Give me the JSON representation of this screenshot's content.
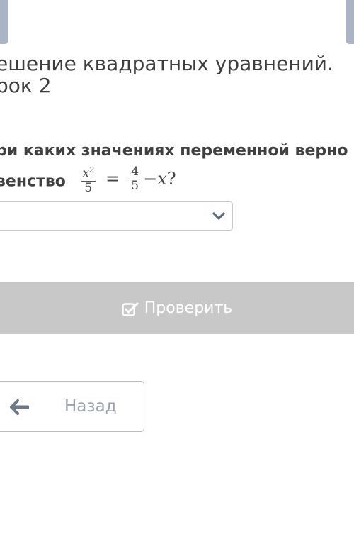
{
  "header": {
    "left_button_icon": "nav-button",
    "right_button_icon": "nav-button"
  },
  "lesson": {
    "title_line1": "ешение квадратных уравнений.",
    "title_line2": "рок 2"
  },
  "question": {
    "line1": "ри каких значениях переменной верно",
    "line2_prefix": "венство",
    "formula": {
      "lhs_num_var": "x",
      "lhs_num_exp": "2",
      "lhs_den": "5",
      "equals": "=",
      "rhs_num": "4",
      "rhs_den": "5",
      "minus": "−",
      "var": "x",
      "qmark": "?"
    }
  },
  "answer_select": {
    "value": "",
    "icon": "chevron-down-icon",
    "accent_color": "#5b6a7d"
  },
  "actions": {
    "check_label": "Проверить",
    "check_icon": "checkbox-icon",
    "check_bg": "#c8c8c8",
    "back_label": "Назад",
    "back_icon": "arrow-left-icon"
  }
}
